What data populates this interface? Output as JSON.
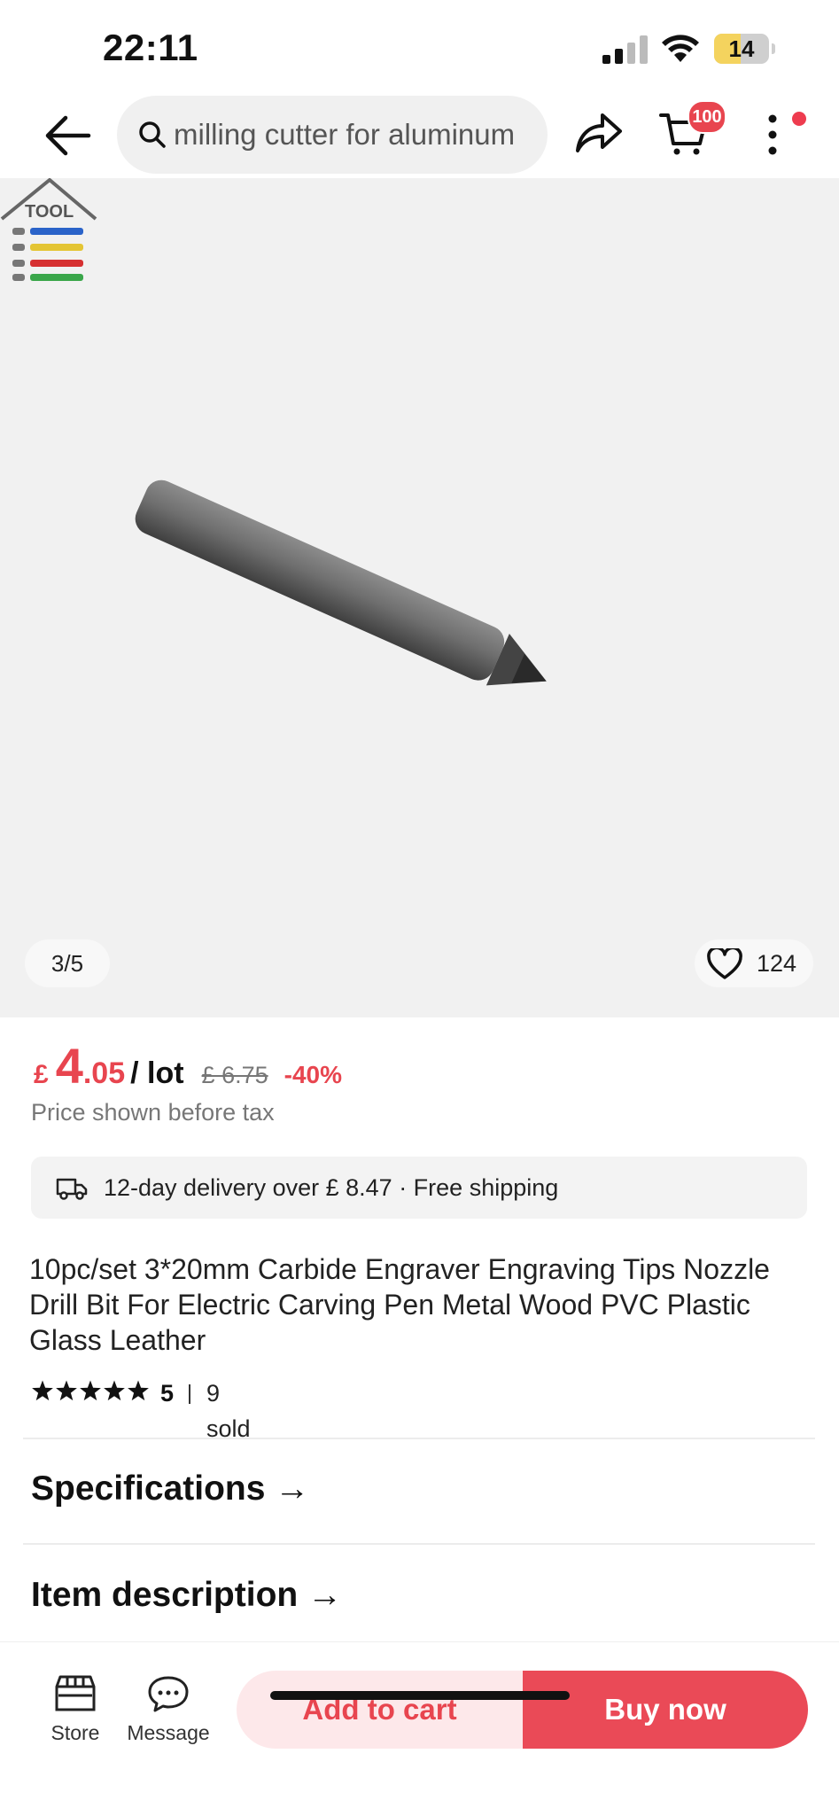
{
  "status_bar": {
    "time": "22:11",
    "battery": "14"
  },
  "nav": {
    "search_text": "milling cutter for aluminum",
    "cart_badge": "100"
  },
  "gallery": {
    "pager": "3/5",
    "favorites": "124"
  },
  "price": {
    "currency": "£",
    "integer": "4",
    "decimal": ".05",
    "unit": "/ lot",
    "original": "£ 6.75",
    "discount": "-40%",
    "tax_note": "Price shown before tax"
  },
  "delivery": {
    "text": "12-day delivery over  £ 8.47 · Free shipping"
  },
  "product": {
    "title": "10pc/set 3*20mm Carbide Engraver Engraving Tips Nozzle Drill Bit For Electric Carving Pen Metal Wood PVC Plastic Glass Leather",
    "rating": "5",
    "sold": "9 sold",
    "stars": 5
  },
  "sections": {
    "specifications": "Specifications",
    "item_description": "Item description"
  },
  "bottom_bar": {
    "store": "Store",
    "message": "Message",
    "add_to_cart": "Add to cart",
    "buy_now": "Buy now"
  },
  "colors": {
    "accent": "#e8454f",
    "accent_light": "#fde8ea"
  }
}
